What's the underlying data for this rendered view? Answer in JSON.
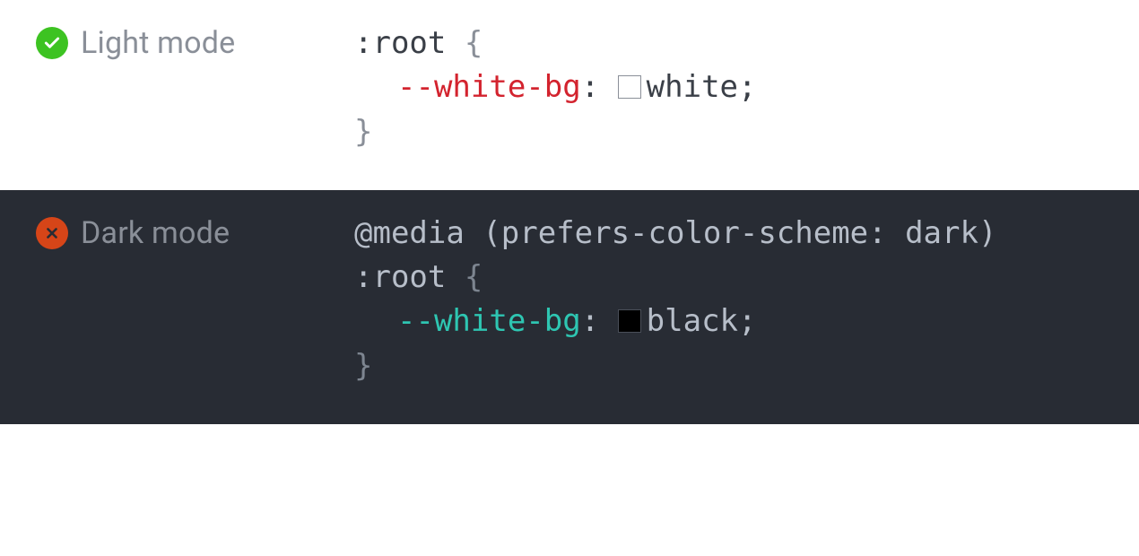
{
  "light": {
    "label": "Light mode",
    "selector": ":root",
    "openBrace": "{",
    "closeBrace": "}",
    "prop": "--white-bg",
    "sep": ": ",
    "value": "white",
    "semi": ";"
  },
  "dark": {
    "label": "Dark mode",
    "media": "@media (prefers-color-scheme: dark)",
    "selector": ":root",
    "openBrace": "{",
    "closeBrace": "}",
    "prop": "--white-bg",
    "sep": ": ",
    "value": "black",
    "semi": ";"
  }
}
